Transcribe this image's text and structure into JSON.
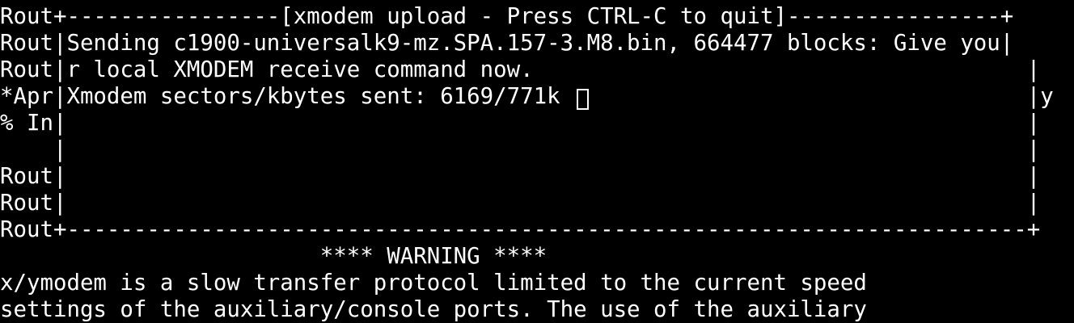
{
  "terminal": {
    "colors": {
      "background": "#000000",
      "foreground": "#ffffff"
    },
    "cursor": "block-cursor",
    "lines": [
      "Rout+----------------[xmodem upload - Press CTRL-C to quit]----------------+",
      "Rout|Sending c1900-universalk9-mz.SPA.157-3.M8.bin, 664477 blocks: Give you|",
      "Rout|r local XMODEM receive command now.                                     |",
      "*Apr|Xmodem sectors/kbytes sent: 6169/771k                                   |y",
      "% In|                                                                        |",
      "    |                                                                        |",
      "Rout|                                                                        |",
      "Rout|                                                                        |",
      "Rout+------------------------------------------------------------------------+",
      "                        **** WARNING ****",
      "x/ymodem is a slow transfer protocol limited to the current speed",
      "settings of the auxiliary/console ports. The use of the auxiliary"
    ]
  }
}
